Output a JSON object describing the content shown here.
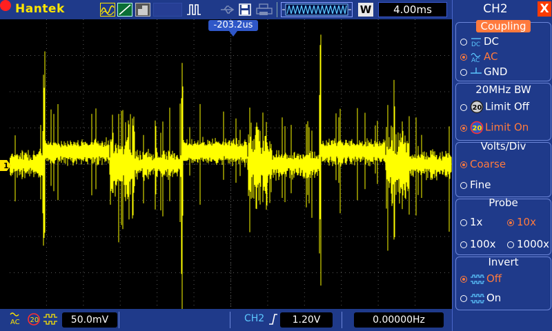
{
  "topbar": {
    "brand": "Hantek",
    "time_div": "4.00ms",
    "mode_badge": "W",
    "icons": [
      "waveform-icon",
      "ramp-icon",
      "envelope-icon",
      "run-stop-icon",
      "record-icon",
      "usb-icon",
      "save-icon",
      "print-icon",
      "memory-waveform-icon"
    ]
  },
  "screen": {
    "trigger_time": "-203.2us",
    "channel_marker": "1",
    "trace_color": "#ffff00",
    "grid_color": "#5a5a5a"
  },
  "status": {
    "coupling_glyph": "AC",
    "bw_glyph": "20",
    "volts_div": "50.0mV",
    "trigger_channel": "CH2",
    "trigger_level": "1.20V",
    "frequency": "0.00000Hz"
  },
  "panel": {
    "title": "CH2",
    "close_label": "X",
    "coupling": {
      "title": "Coupling",
      "options": [
        {
          "glyph": "DC",
          "label": "DC",
          "selected": false
        },
        {
          "glyph": "AC",
          "label": "AC",
          "selected": true
        },
        {
          "glyph": "GND",
          "label": "GND",
          "selected": false
        }
      ]
    },
    "bandwidth": {
      "title": "20MHz BW",
      "options": [
        {
          "glyph": "20",
          "label": "Limit Off",
          "selected": false
        },
        {
          "glyph": "20",
          "label": "Limit On",
          "selected": true
        }
      ]
    },
    "volts": {
      "title": "Volts/Div",
      "options": [
        {
          "label": "Coarse",
          "selected": true
        },
        {
          "label": "Fine",
          "selected": false
        }
      ]
    },
    "probe": {
      "title": "Probe",
      "options": [
        {
          "label": "1x",
          "selected": false
        },
        {
          "label": "10x",
          "selected": true
        },
        {
          "label": "100x",
          "selected": false
        },
        {
          "label": "1000x",
          "selected": false
        }
      ]
    },
    "invert": {
      "title": "Invert",
      "options": [
        {
          "label": "Off",
          "selected": true
        },
        {
          "label": "On",
          "selected": false
        }
      ]
    }
  },
  "colors": {
    "panel_bg": "#1f3a8a",
    "accent_yellow": "#ffe600",
    "selected_orange": "#ff7a3d",
    "trigger_cyan": "#5cc8ff"
  }
}
